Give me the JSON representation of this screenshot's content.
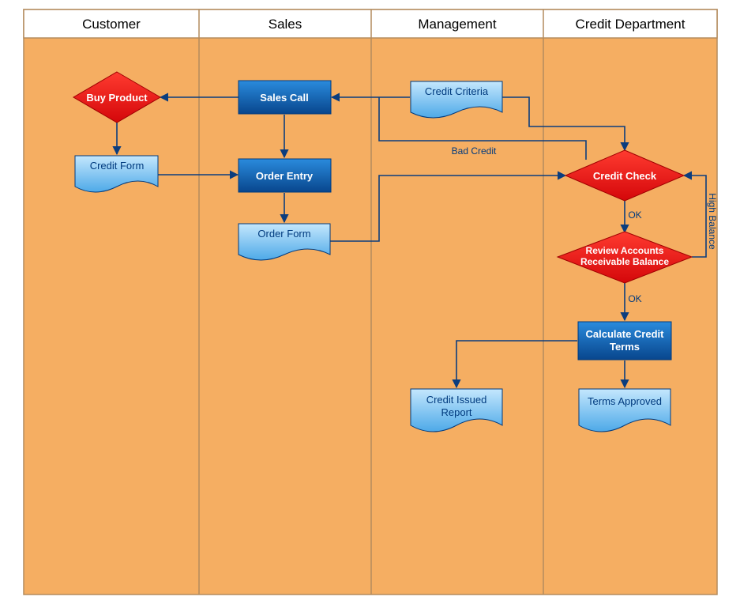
{
  "lanes": {
    "customer": "Customer",
    "sales": "Sales",
    "management": "Management",
    "credit": "Credit Department"
  },
  "nodes": {
    "buy_product": "Buy Product",
    "credit_form": "Credit Form",
    "sales_call": "Sales Call",
    "order_entry": "Order Entry",
    "order_form": "Order Form",
    "credit_criteria": "Credit Criteria",
    "credit_check": "Credit Check",
    "review_accounts_l1": "Review Accounts",
    "review_accounts_l2": "Receivable Balance",
    "calculate_credit_l1": "Calculate Credit",
    "calculate_credit_l2": "Terms",
    "credit_issued_l1": "Credit Issued",
    "credit_issued_l2": "Report",
    "terms_approved": "Terms Approved"
  },
  "edge_labels": {
    "bad_credit": "Bad Credit",
    "ok1": "OK",
    "ok2": "OK",
    "high_balance": "High Balance"
  },
  "colors": {
    "lane_stroke": "#b48c5e",
    "lane_fill": "#f5ae62",
    "process_fill1": "#1c78d6",
    "process_fill2": "#0a4b94",
    "process_stroke": "#003a7e",
    "decision_fill1": "#ff3b30",
    "decision_fill2": "#d4070a",
    "decision_stroke": "#a00000",
    "doc_fill1": "#8fd0fb",
    "doc_fill2": "#5eb9f1",
    "doc_stroke": "#003a7e",
    "connector": "#0b3d7e"
  }
}
